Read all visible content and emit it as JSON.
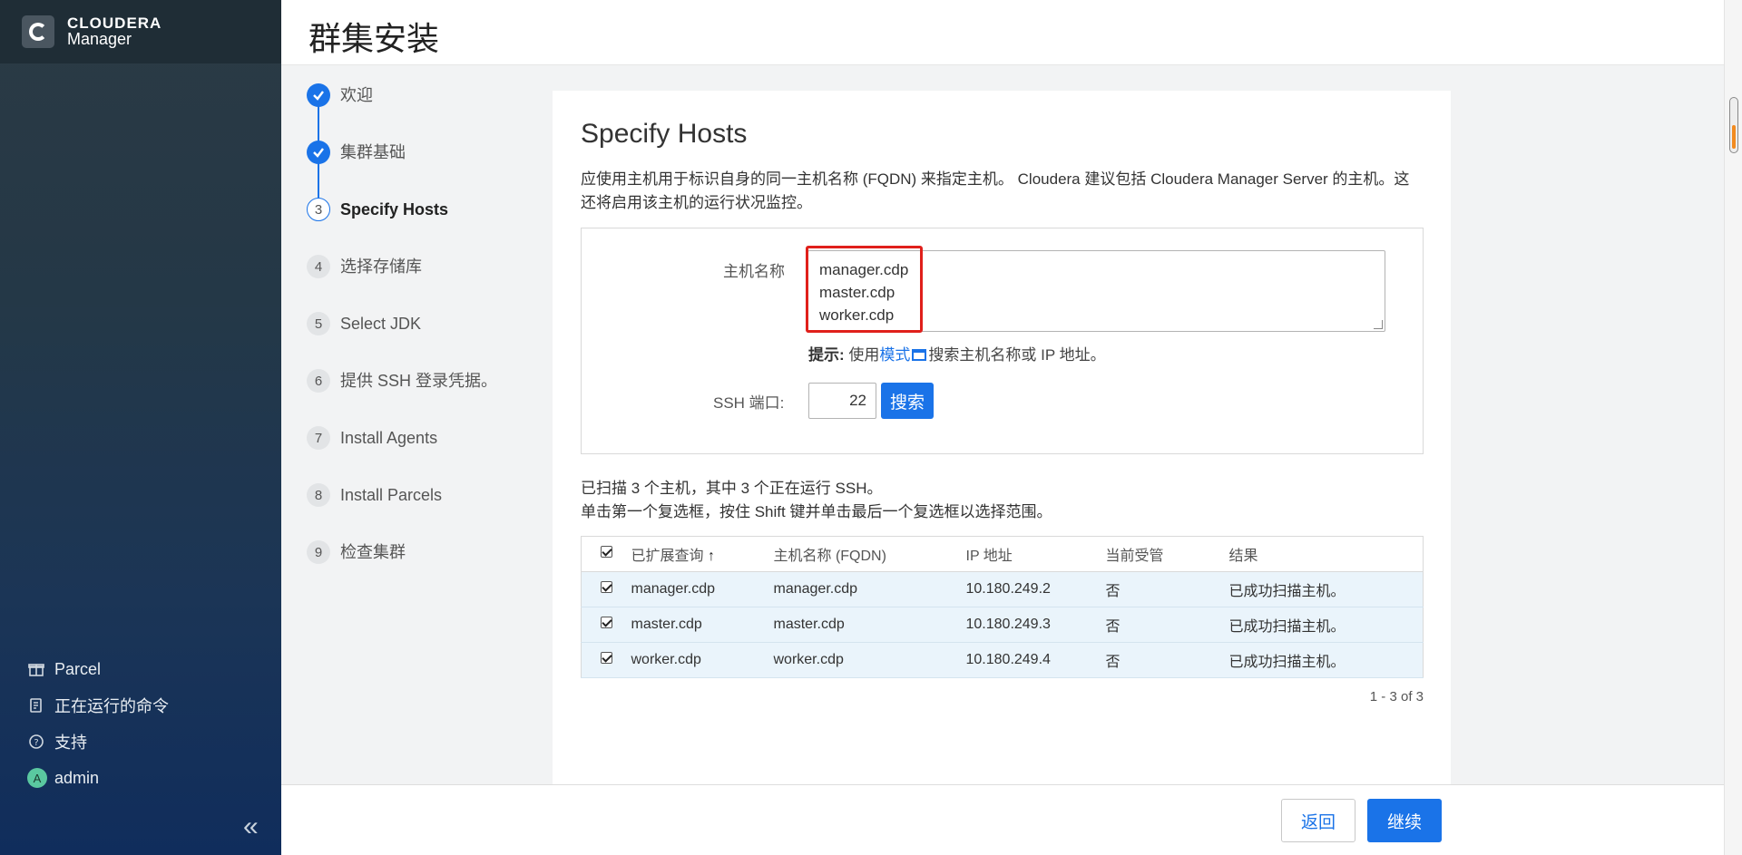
{
  "brand": {
    "line1": "CLOUDERA",
    "line2": "Manager"
  },
  "page_title": "群集安装",
  "steps": [
    {
      "num": "1",
      "label": "欢迎",
      "state": "done"
    },
    {
      "num": "2",
      "label": "集群基础",
      "state": "done"
    },
    {
      "num": "3",
      "label": "Specify Hosts",
      "state": "active"
    },
    {
      "num": "4",
      "label": "选择存储库",
      "state": "todo"
    },
    {
      "num": "5",
      "label": "Select JDK",
      "state": "todo"
    },
    {
      "num": "6",
      "label": "提供 SSH 登录凭据。",
      "state": "todo"
    },
    {
      "num": "7",
      "label": "Install Agents",
      "state": "todo"
    },
    {
      "num": "8",
      "label": "Install Parcels",
      "state": "todo"
    },
    {
      "num": "9",
      "label": "检查集群",
      "state": "todo"
    }
  ],
  "sidebar": {
    "items": [
      {
        "label": "Parcel",
        "icon": "gift-icon"
      },
      {
        "label": "正在运行的命令",
        "icon": "commands-icon"
      },
      {
        "label": "支持",
        "icon": "help-icon"
      },
      {
        "label": "admin",
        "icon": "avatar",
        "avatar_letter": "A"
      }
    ],
    "collapse": "«"
  },
  "main": {
    "title": "Specify Hosts",
    "description_line1": "应使用主机用于标识自身的同一主机名称 (FQDN) 来指定主机。 Cloudera 建议包括 Cloudera Manager Server 的主机。这",
    "description_line2": "还将启用该主机的运行状况监控。",
    "hostname_label": "主机名称",
    "hostnames": [
      "manager.cdp",
      "master.cdp",
      "worker.cdp"
    ],
    "hint_bold": "提示:",
    "hint_prefix": " 使用",
    "hint_link": "模式",
    "hint_suffix": "搜索主机名称或 IP 地址。",
    "ssh_port_label": "SSH 端口:",
    "ssh_port_value": "22",
    "search_button": "搜索",
    "scan_line1": "已扫描 3 个主机，其中 3 个正在运行 SSH。",
    "scan_line2": "单击第一个复选框，按住 Shift 键并单击最后一个复选框以选择范围。",
    "table": {
      "headers": [
        "已扩展查询",
        "主机名称 (FQDN)",
        "IP 地址",
        "当前受管",
        "结果"
      ],
      "sort_indicator": "↑",
      "rows": [
        {
          "query": "manager.cdp",
          "fqdn": "manager.cdp",
          "ip": "10.180.249.2",
          "managed": "否",
          "result": "已成功扫描主机。"
        },
        {
          "query": "master.cdp",
          "fqdn": "master.cdp",
          "ip": "10.180.249.3",
          "managed": "否",
          "result": "已成功扫描主机。"
        },
        {
          "query": "worker.cdp",
          "fqdn": "worker.cdp",
          "ip": "10.180.249.4",
          "managed": "否",
          "result": "已成功扫描主机。"
        }
      ]
    },
    "pager": "1 - 3 of 3"
  },
  "footer": {
    "back": "返回",
    "next": "继续"
  },
  "colors": {
    "accent": "#1a73e8",
    "highlight": "#e0201b",
    "row_bg": "#eaf4fb"
  }
}
